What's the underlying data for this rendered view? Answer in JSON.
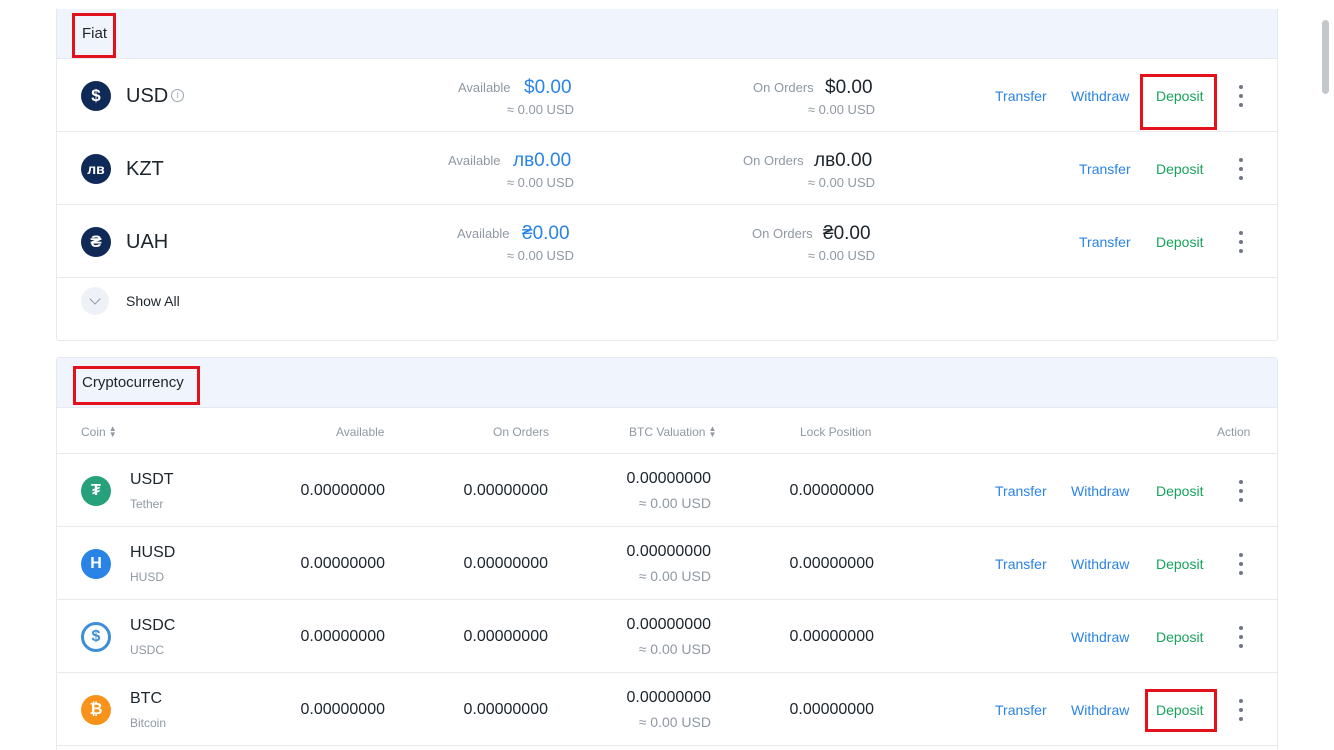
{
  "fiat": {
    "title": "Fiat",
    "rows": [
      {
        "name": "USD",
        "symbol": "$",
        "available_label": "Available",
        "available": "$0.00",
        "available_usd": "≈ 0.00 USD",
        "orders_label": "On Orders",
        "orders": "$0.00",
        "orders_usd": "≈ 0.00 USD",
        "actions": [
          "Transfer",
          "Withdraw",
          "Deposit"
        ]
      },
      {
        "name": "KZT",
        "symbol": "лв",
        "available_label": "Available",
        "available": "лв0.00",
        "available_usd": "≈ 0.00 USD",
        "orders_label": "On Orders",
        "orders": "лв0.00",
        "orders_usd": "≈ 0.00 USD",
        "actions": [
          "Transfer",
          "Deposit"
        ]
      },
      {
        "name": "UAH",
        "symbol": "₴",
        "available_label": "Available",
        "available": "₴0.00",
        "available_usd": "≈ 0.00 USD",
        "orders_label": "On Orders",
        "orders": "₴0.00",
        "orders_usd": "≈ 0.00 USD",
        "actions": [
          "Transfer",
          "Deposit"
        ]
      }
    ],
    "show_all": "Show All"
  },
  "crypto": {
    "title": "Cryptocurrency",
    "headers": {
      "coin": "Coin",
      "available": "Available",
      "on_orders": "On Orders",
      "btc_valuation": "BTC Valuation",
      "lock_position": "Lock Position",
      "action": "Action"
    },
    "rows": [
      {
        "symbol": "USDT",
        "name": "Tether",
        "icon_glyph": "₮",
        "icon_color": "#26a17b",
        "available": "0.00000000",
        "on_orders": "0.00000000",
        "btc": "0.00000000",
        "btc_usd": "≈ 0.00 USD",
        "lock": "0.00000000",
        "transfer": "Transfer",
        "withdraw": "Withdraw",
        "deposit": "Deposit"
      },
      {
        "symbol": "HUSD",
        "name": "HUSD",
        "icon_glyph": "H",
        "icon_color": "#2a83e6",
        "available": "0.00000000",
        "on_orders": "0.00000000",
        "btc": "0.00000000",
        "btc_usd": "≈ 0.00 USD",
        "lock": "0.00000000",
        "transfer": "Transfer",
        "withdraw": "Withdraw",
        "deposit": "Deposit"
      },
      {
        "symbol": "USDC",
        "name": "USDC",
        "icon_glyph": "$",
        "icon_color": "#3e8fd8",
        "available": "0.00000000",
        "on_orders": "0.00000000",
        "btc": "0.00000000",
        "btc_usd": "≈ 0.00 USD",
        "lock": "0.00000000",
        "transfer": "",
        "withdraw": "Withdraw",
        "deposit": "Deposit"
      },
      {
        "symbol": "BTC",
        "name": "Bitcoin",
        "icon_glyph": "₿",
        "icon_color": "#f7931a",
        "available": "0.00000000",
        "on_orders": "0.00000000",
        "btc": "0.00000000",
        "btc_usd": "≈ 0.00 USD",
        "lock": "0.00000000",
        "transfer": "Transfer",
        "withdraw": "Withdraw",
        "deposit": "Deposit"
      }
    ]
  },
  "colors": {
    "link_blue": "#2a83e6",
    "deposit_green": "#18a35b",
    "highlight_red": "#e3111b",
    "header_bg": "#f0f4fc"
  }
}
